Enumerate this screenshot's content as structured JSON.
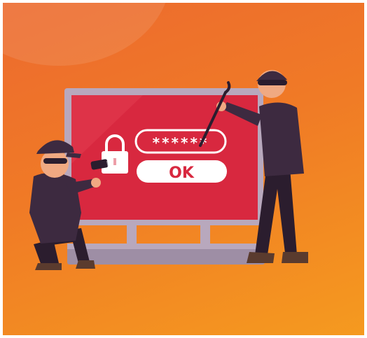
{
  "login_panel": {
    "password_mask": "******",
    "ok_button_label": "OK"
  },
  "colors": {
    "background_top": "#ec6a2f",
    "background_bottom": "#f59a1f",
    "screen_red": "#d8283f",
    "monitor_frame": "#b8a8bd",
    "outfit_dark": "#3d2a40",
    "skin": "#f0a982",
    "button_white": "#ffffff"
  },
  "icons": [
    "padlock-icon"
  ]
}
